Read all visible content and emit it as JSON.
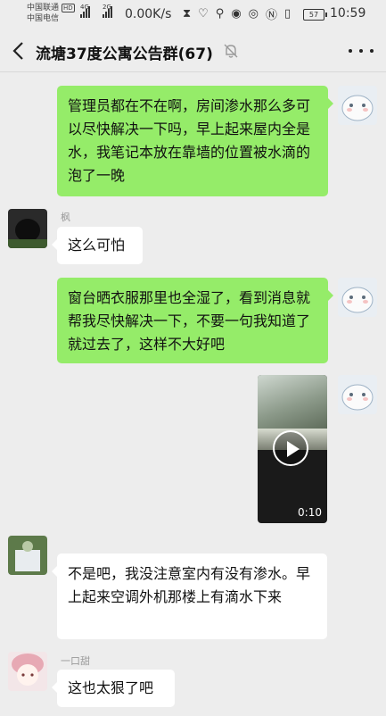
{
  "status_bar": {
    "carrier1": "中国联通",
    "carrier1_badge": "HD",
    "carrier2": "中国电信",
    "signal1_label": "4G",
    "signal2_label": "2G",
    "net_speed": "0.00K/s",
    "battery": "57",
    "time": "10:59"
  },
  "header": {
    "title": "流塘37度公寓公告群(67)"
  },
  "messages": [
    {
      "sender": "me",
      "text": "管理员都在不在啊，房间渗水那么多可以尽快解决一下吗，早上起来屋内全是水，我笔记本放在靠墙的位置被水滴的泡了一晚"
    },
    {
      "sender_name": "枫",
      "text": "这么可怕"
    },
    {
      "sender": "me",
      "text": "窗台晒衣服那里也全湿了，看到消息就帮我尽快解决一下，不要一句我知道了就过去了，这样不大好吧"
    },
    {
      "sender": "me",
      "type": "video",
      "duration": "0:10"
    },
    {
      "sender_name": "",
      "text": "不是吧，我没注意室内有没有渗水。早上起来空调外机那楼上有滴水下来"
    },
    {
      "sender_name": "一口甜",
      "text": "这也太狠了吧"
    }
  ],
  "colors": {
    "self_bubble": "#95ec69",
    "other_bubble": "#ffffff",
    "background": "#ededed"
  }
}
